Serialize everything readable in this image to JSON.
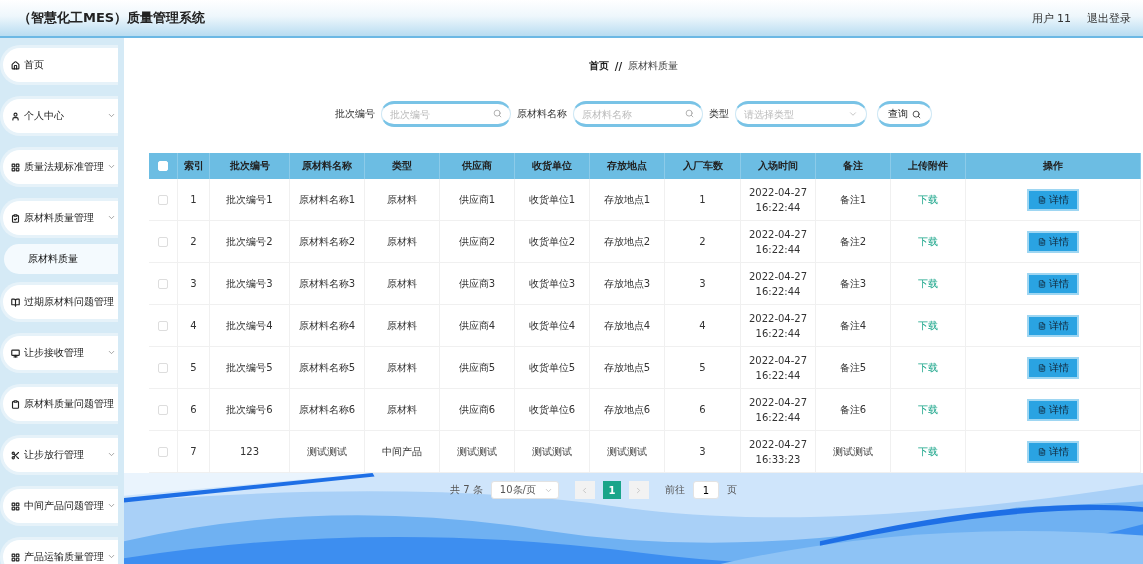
{
  "header": {
    "title": "（智慧化工MES）质量管理系统",
    "user": "用户 11",
    "logout": "退出登录"
  },
  "sidebar": {
    "items": [
      {
        "label": "首页",
        "expandable": false,
        "selected": false
      },
      {
        "label": "个人中心",
        "expandable": true,
        "selected": false
      },
      {
        "label": "质量法规标准管理",
        "expandable": true,
        "selected": false
      },
      {
        "label": "原材料质量管理",
        "expandable": true,
        "selected": false,
        "children": [
          {
            "label": "原材料质量",
            "selected": true
          }
        ]
      },
      {
        "label": "过期原材料问题管理",
        "expandable": false,
        "selected": false
      },
      {
        "label": "让步接收管理",
        "expandable": true,
        "selected": false
      },
      {
        "label": "原材料质量问题管理",
        "expandable": false,
        "selected": false
      },
      {
        "label": "让步放行管理",
        "expandable": true,
        "selected": false
      },
      {
        "label": "中间产品问题管理",
        "expandable": true,
        "selected": false
      },
      {
        "label": "产品运输质量管理",
        "expandable": true,
        "selected": false
      }
    ]
  },
  "breadcrumb": {
    "home": "首页",
    "separator": "//",
    "current": "原材料质量"
  },
  "search": {
    "fields": [
      {
        "kind": "text",
        "label": "批次编号",
        "placeholder": "批次编号"
      },
      {
        "kind": "text",
        "label": "原材料名称",
        "placeholder": "原材料名称"
      },
      {
        "kind": "select",
        "label": "类型",
        "placeholder": "请选择类型"
      }
    ],
    "button": "查询"
  },
  "table": {
    "all_checked": false,
    "columns": [
      "索引",
      "批次编号",
      "原材料名称",
      "类型",
      "供应商",
      "收货单位",
      "存放地点",
      "入厂车数",
      "入场时间",
      "备注",
      "上传附件",
      "操作"
    ],
    "rows": [
      {
        "checked": false,
        "cells": [
          "1",
          "批次编号1",
          "原材料名称1",
          "原材料",
          "供应商1",
          "收货单位1",
          "存放地点1",
          "1",
          "2022-04-27 16:22:44",
          "备注1"
        ],
        "download": "下载",
        "action": "详情"
      },
      {
        "checked": false,
        "cells": [
          "2",
          "批次编号2",
          "原材料名称2",
          "原材料",
          "供应商2",
          "收货单位2",
          "存放地点2",
          "2",
          "2022-04-27 16:22:44",
          "备注2"
        ],
        "download": "下载",
        "action": "详情"
      },
      {
        "checked": false,
        "cells": [
          "3",
          "批次编号3",
          "原材料名称3",
          "原材料",
          "供应商3",
          "收货单位3",
          "存放地点3",
          "3",
          "2022-04-27 16:22:44",
          "备注3"
        ],
        "download": "下载",
        "action": "详情"
      },
      {
        "checked": false,
        "cells": [
          "4",
          "批次编号4",
          "原材料名称4",
          "原材料",
          "供应商4",
          "收货单位4",
          "存放地点4",
          "4",
          "2022-04-27 16:22:44",
          "备注4"
        ],
        "download": "下载",
        "action": "详情"
      },
      {
        "checked": false,
        "cells": [
          "5",
          "批次编号5",
          "原材料名称5",
          "原材料",
          "供应商5",
          "收货单位5",
          "存放地点5",
          "5",
          "2022-04-27 16:22:44",
          "备注5"
        ],
        "download": "下载",
        "action": "详情"
      },
      {
        "checked": false,
        "cells": [
          "6",
          "批次编号6",
          "原材料名称6",
          "原材料",
          "供应商6",
          "收货单位6",
          "存放地点6",
          "6",
          "2022-04-27 16:22:44",
          "备注6"
        ],
        "download": "下载",
        "action": "详情"
      },
      {
        "checked": false,
        "cells": [
          "7",
          "123",
          "测试测试",
          "中间产品",
          "测试测试",
          "测试测试",
          "测试测试",
          "3",
          "2022-04-27 16:33:23",
          "测试测试"
        ],
        "download": "下载",
        "action": "详情"
      }
    ]
  },
  "pagination": {
    "total": "共 7 条",
    "page_size": "10条/页",
    "pages": [
      {
        "label": "1",
        "selected": true
      }
    ],
    "goto_label": "前往",
    "goto_value": "1",
    "goto_suffix": "页"
  }
}
